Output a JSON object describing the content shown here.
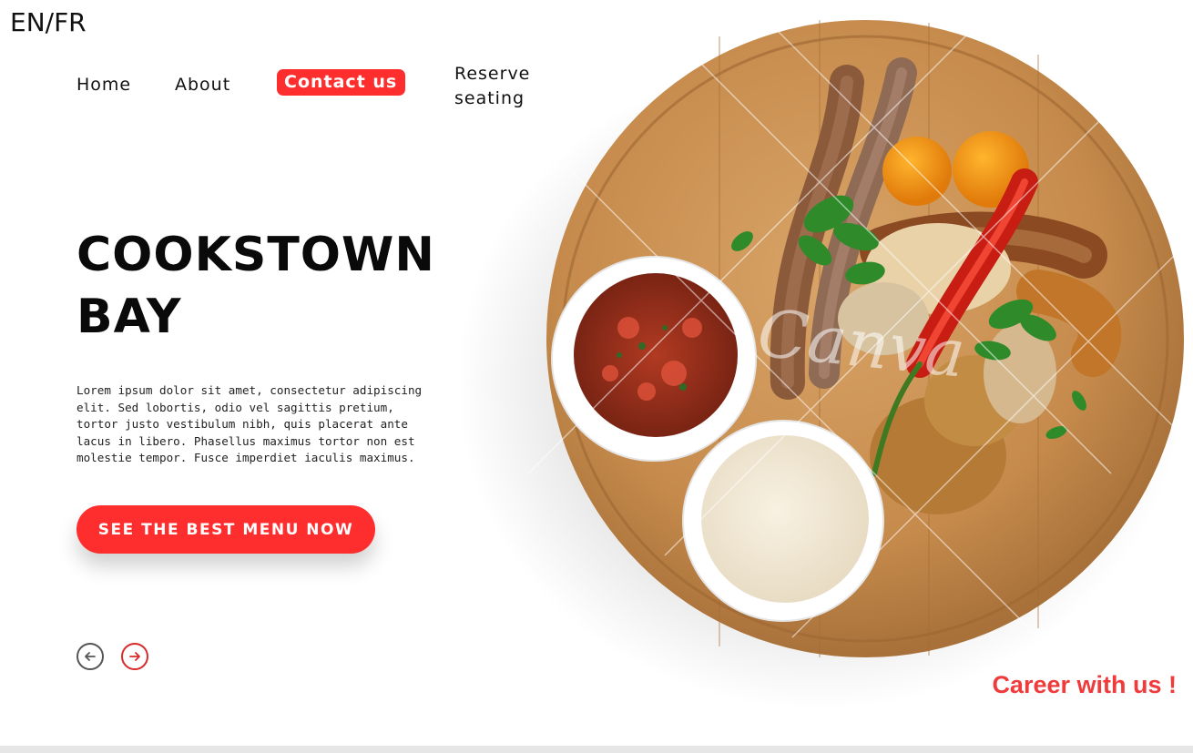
{
  "header": {
    "language_toggle": "EN/FR"
  },
  "nav": {
    "items": [
      {
        "label": "Home"
      },
      {
        "label": "About"
      },
      {
        "label": "Contact us"
      },
      {
        "label": "Reserve seating"
      }
    ]
  },
  "hero": {
    "title_line1": "COOKSTOWN",
    "title_line2": "BAY",
    "body": "Lorem ipsum dolor sit amet, consectetur adipiscing elit. Sed lobortis, odio vel sagittis pretium, tortor justo vestibulum nibh, quis placerat ante lacus in libero. Phasellus maximus tortor non est molestie tempor. Fusce imperdiet iaculis maximus.",
    "cta_label": "SEE THE BEST MENU NOW"
  },
  "carousel": {
    "prev_icon": "arrow-left-circle-icon",
    "next_icon": "arrow-right-circle-icon"
  },
  "career": {
    "label": "Career with us !"
  },
  "image": {
    "description_icon": "food-platter-image",
    "watermark_text": "Canva"
  },
  "colors": {
    "accent": "#ff2e2e",
    "career": "#ef3b3b",
    "text": "#111111",
    "board": "#c98d4e"
  }
}
